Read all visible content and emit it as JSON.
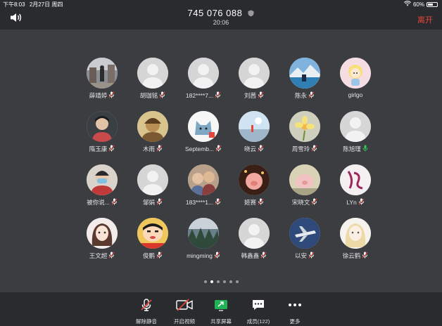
{
  "status": {
    "time": "下午8:03",
    "date": "2月27日 周四",
    "battery": "60%",
    "battery_level": 0.6
  },
  "meeting": {
    "id": "745 076 088",
    "duration": "20:06",
    "leave_label": "离开"
  },
  "colors": {
    "accent_red": "#e6463c",
    "mic_blue": "#3c8de6",
    "mic_green": "#34c759"
  },
  "participants": [
    {
      "name": "薛靖婷",
      "mic": "muted",
      "avatar": "photo-street"
    },
    {
      "name": "胡珈铭",
      "mic": "muted",
      "avatar": "default"
    },
    {
      "name": "182****7...",
      "mic": "muted",
      "avatar": "default"
    },
    {
      "name": "刘茜",
      "mic": "muted",
      "avatar": "default"
    },
    {
      "name": "陈永",
      "mic": "muted",
      "avatar": "photo-lake"
    },
    {
      "name": "girlgo",
      "mic": "none",
      "avatar": "cartoon-girl"
    },
    {
      "name": "隋玉康",
      "mic": "muted",
      "avatar": "photo-kid"
    },
    {
      "name": "木雨",
      "mic": "muted",
      "avatar": "photo-sepia"
    },
    {
      "name": "Septemb...",
      "mic": "muted",
      "avatar": "cartoon-cat"
    },
    {
      "name": "晓云",
      "mic": "muted",
      "avatar": "photo-sky"
    },
    {
      "name": "周雪玲",
      "mic": "muted",
      "avatar": "photo-flower"
    },
    {
      "name": "陈旭瑾",
      "mic": "active",
      "avatar": "default"
    },
    {
      "name": "被你说...",
      "mic": "muted",
      "avatar": "photo-mask"
    },
    {
      "name": "邹娟",
      "mic": "muted",
      "avatar": "default"
    },
    {
      "name": "183****1...",
      "mic": "muted",
      "avatar": "photo-kids"
    },
    {
      "name": "姬赛",
      "mic": "muted",
      "avatar": "photo-pig"
    },
    {
      "name": "宋晓文",
      "mic": "muted",
      "avatar": "cartoon-pig"
    },
    {
      "name": "LYn",
      "mic": "muted",
      "avatar": "calligraphy"
    },
    {
      "name": "王文超",
      "mic": "muted",
      "avatar": "anime-girl"
    },
    {
      "name": "俊鹏",
      "mic": "muted",
      "avatar": "cartoon-shinchan"
    },
    {
      "name": "mingming",
      "mic": "muted",
      "avatar": "photo-forest"
    },
    {
      "name": "韩鑫鑫",
      "mic": "muted",
      "avatar": "default"
    },
    {
      "name": "以安",
      "mic": "muted",
      "avatar": "photo-jet"
    },
    {
      "name": "徐云鹤",
      "mic": "muted",
      "avatar": "anime-blonde"
    }
  ],
  "pagination": {
    "count": 6,
    "active": 1
  },
  "toolbar": {
    "unmute": "解除静音",
    "start_video": "开启视频",
    "share_screen": "共享屏幕",
    "members": "成员(122)",
    "more": "更多"
  }
}
